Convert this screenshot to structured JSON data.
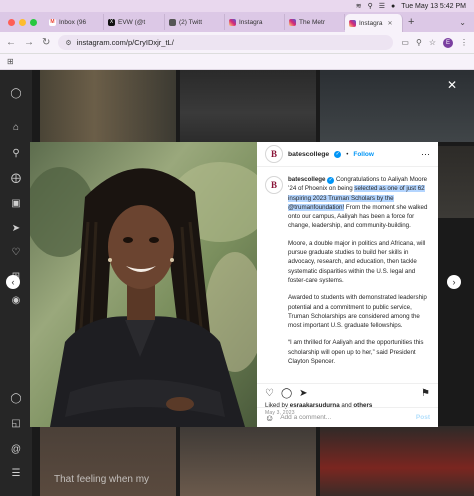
{
  "menubar": {
    "datetime": "Tue May 13  5:42 PM"
  },
  "tabs": [
    {
      "label": "Inbox (96",
      "favicon": "gmail-icon",
      "color": "#ea4335",
      "glyph": "M"
    },
    {
      "label": "EVW (@t",
      "favicon": "x-icon",
      "color": "#111111",
      "glyph": "X"
    },
    {
      "label": "(2) Twitt",
      "favicon": "twitter-icon",
      "color": "#555555",
      "glyph": ""
    },
    {
      "label": "Instagra",
      "favicon": "instagram-icon",
      "color": "#d62976",
      "glyph": ""
    },
    {
      "label": "The Metr",
      "favicon": "instagram-icon",
      "color": "#d62976",
      "glyph": ""
    },
    {
      "label": "Instagra",
      "favicon": "instagram-icon",
      "color": "#d62976",
      "glyph": "",
      "active": true
    }
  ],
  "address": {
    "url": "instagram.com/p/CryIDxjr_tL/",
    "profile_initial": "E"
  },
  "post": {
    "username": "batescollege",
    "follow_label": "Follow",
    "avatar_letter": "B",
    "caption_lead": "Congratulations to Aaliyah Moore ’24 of Phoenix on being ",
    "caption_highlight": "selected as one of just 62 inspiring 2023 Truman Scholars by the @trumanfoundation!",
    "caption_rest": " From the moment she walked onto our campus, Aaliyah has been a force for change, leadership, and community-building.",
    "para2": "Moore, a double major in politics and Africana, will pursue graduate studies to build her skills in advocacy, research, and education, then tackle systematic disparities within the U.S. legal and foster-care systems.",
    "para3": "Awarded to students with demonstrated leadership potential and a commitment to public service, Truman Scholarships are considered among the most important U.S. graduate fellowships.",
    "para4": "“I am thrilled for Aaliyah and the opportunities this scholarship will open up to her,” said President Clayton Spencer.",
    "liked_prefix": "Liked by ",
    "liked_user": "esraakarsudurna",
    "liked_mid": " and ",
    "liked_others": "others",
    "date": "May 3, 2023",
    "comment_placeholder": "Add a comment...",
    "post_label": "Post"
  },
  "background_post": {
    "overlay_text": "That feeling when my"
  },
  "colors": {
    "brand": "#8a1538",
    "link": "#0095f6",
    "highlight": "#b4d5fe"
  }
}
